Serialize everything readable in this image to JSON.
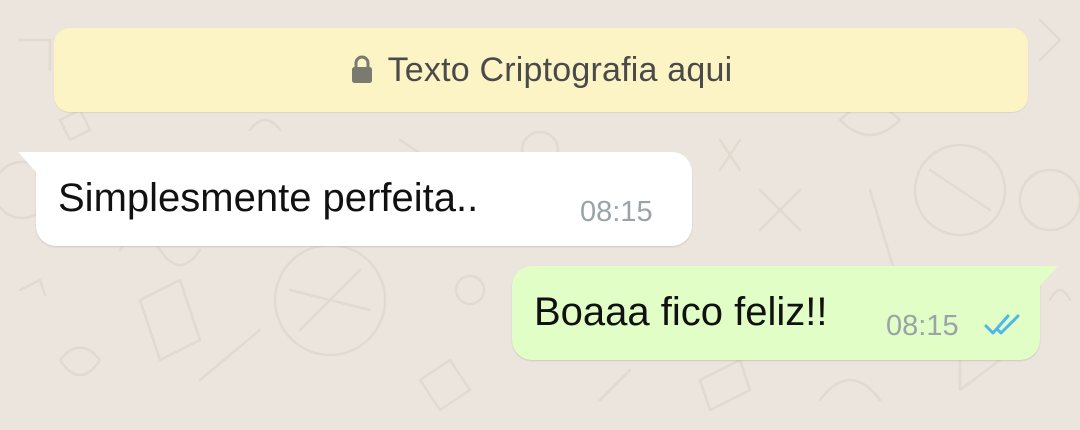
{
  "encryption_notice": {
    "icon": "lock-icon",
    "text": "Texto Criptografia aqui"
  },
  "messages": [
    {
      "direction": "incoming",
      "text": "Simplesmente perfeita..",
      "time": "08:15"
    },
    {
      "direction": "outgoing",
      "text": "Boaaa fico feliz!!",
      "time": "08:15",
      "status_icon": "double-check-read-icon"
    }
  ],
  "colors": {
    "background": "#ece5dd",
    "banner": "#fcf4c4",
    "incoming_bubble": "#ffffff",
    "outgoing_bubble": "#e1fec6",
    "read_ticks": "#4fb6ec"
  }
}
